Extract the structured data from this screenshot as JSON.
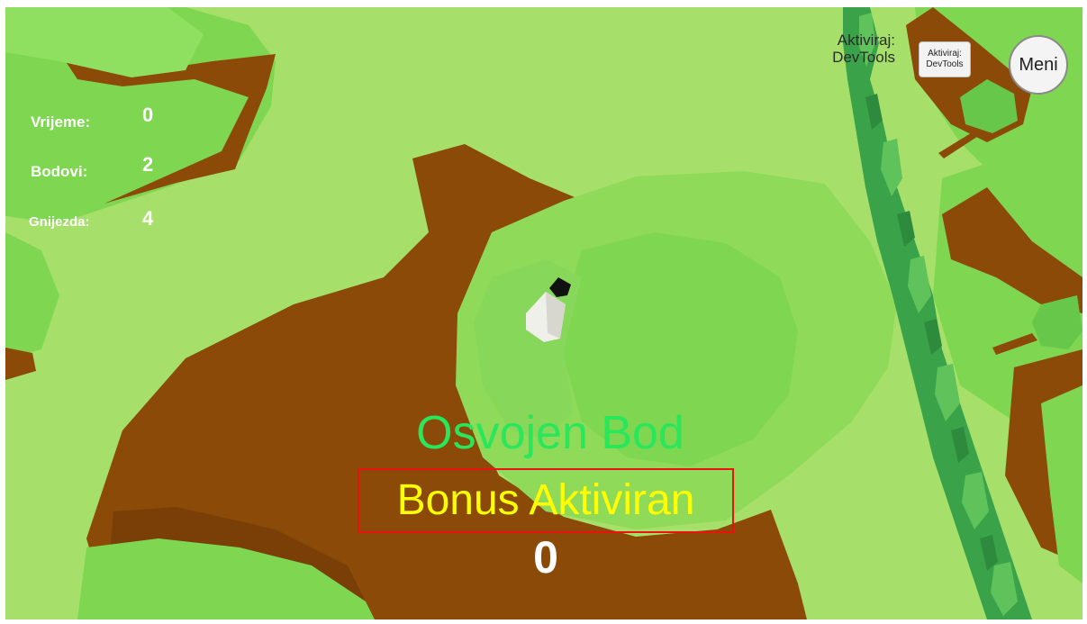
{
  "hud": {
    "time_label": "Vrijeme:",
    "time_value": "0",
    "points_label": "Bodovi:",
    "points_value": "2",
    "nests_label": "Gnijezda:",
    "nests_value": "4"
  },
  "devtools": {
    "text_line1": "Aktiviraj:",
    "text_line2": "DevTools",
    "button_line1": "Aktiviraj:",
    "button_line2": "DevTools"
  },
  "menu": {
    "label": "Meni"
  },
  "messages": {
    "point_won": "Osvojen Bod",
    "bonus": "Bonus Aktiviran",
    "counter": "0"
  },
  "colors": {
    "grass": "#a6e06a",
    "foliage": "#7fd651",
    "foliage_dark": "#4fb63a",
    "trunk": "#8b4a08",
    "point_text": "#2ae65a",
    "bonus_text": "#ffff00",
    "bonus_border": "#ee1111"
  }
}
